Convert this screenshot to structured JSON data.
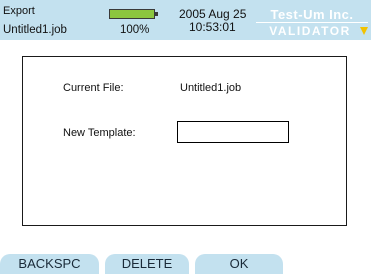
{
  "header": {
    "mode": "Export",
    "file": "Untitled1.job",
    "battery_percent": "100%",
    "battery_level": 1.0,
    "date": "2005 Aug 25",
    "time": "10:53:01",
    "brand": "Test-Um Inc.",
    "product": "VALIDATOR",
    "colors": {
      "header_bg": "#c3e1ef",
      "battery_fill": "#8cc63f",
      "brand_mark": "#f2c200"
    }
  },
  "form": {
    "current_file_label": "Current File:",
    "current_file_value": "Untitled1.job",
    "new_template_label": "New Template:",
    "new_template_value": ""
  },
  "softkeys": {
    "backspace": "BACKSPC",
    "delete": "DELETE",
    "ok": "OK"
  }
}
